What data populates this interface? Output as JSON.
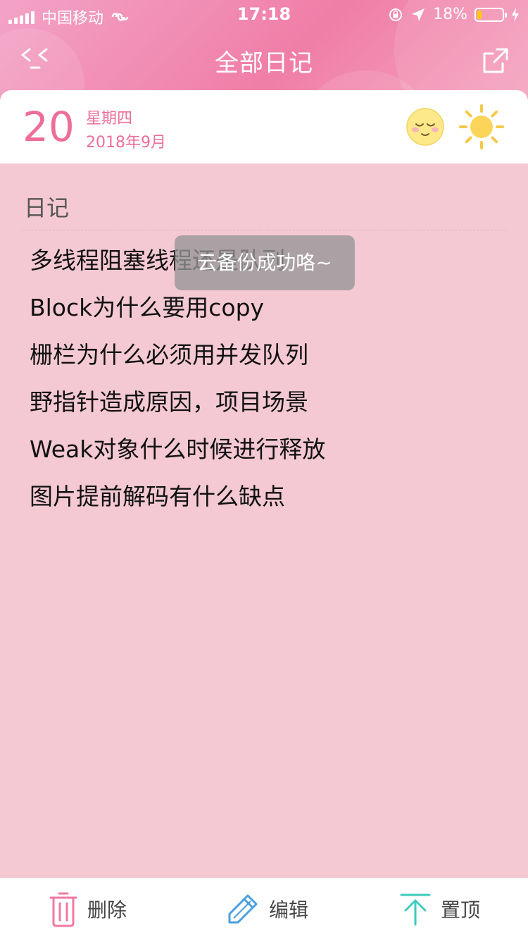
{
  "status_bar": {
    "carrier": "中国移动",
    "time": "17:18",
    "battery": "18%",
    "battery_level": 0.18
  },
  "nav": {
    "title": "全部日记"
  },
  "date_card": {
    "day": "20",
    "weekday": "星期四",
    "month_year": "2018年9月",
    "mood_icon": "sleepy-face-icon",
    "weather_icon": "sun-icon"
  },
  "content": {
    "section_label": "日记",
    "entries": [
      "多线程阻塞线程还是队列",
      "Block为什么要用copy",
      "栅栏为什么必须用并发队列",
      "野指针造成原因，项目场景",
      "Weak对象什么时候进行释放",
      "图片提前解码有什么缺点"
    ]
  },
  "toast": {
    "message": "云备份成功咯~"
  },
  "toolbar": {
    "delete_label": "删除",
    "edit_label": "编辑",
    "pin_label": "置顶"
  },
  "colors": {
    "accent_pink": "#ee6e99",
    "background_pink": "#f5c9d4",
    "delete_icon": "#f07aa0",
    "edit_icon": "#4a9fe2",
    "pin_icon": "#3fcbbd"
  }
}
